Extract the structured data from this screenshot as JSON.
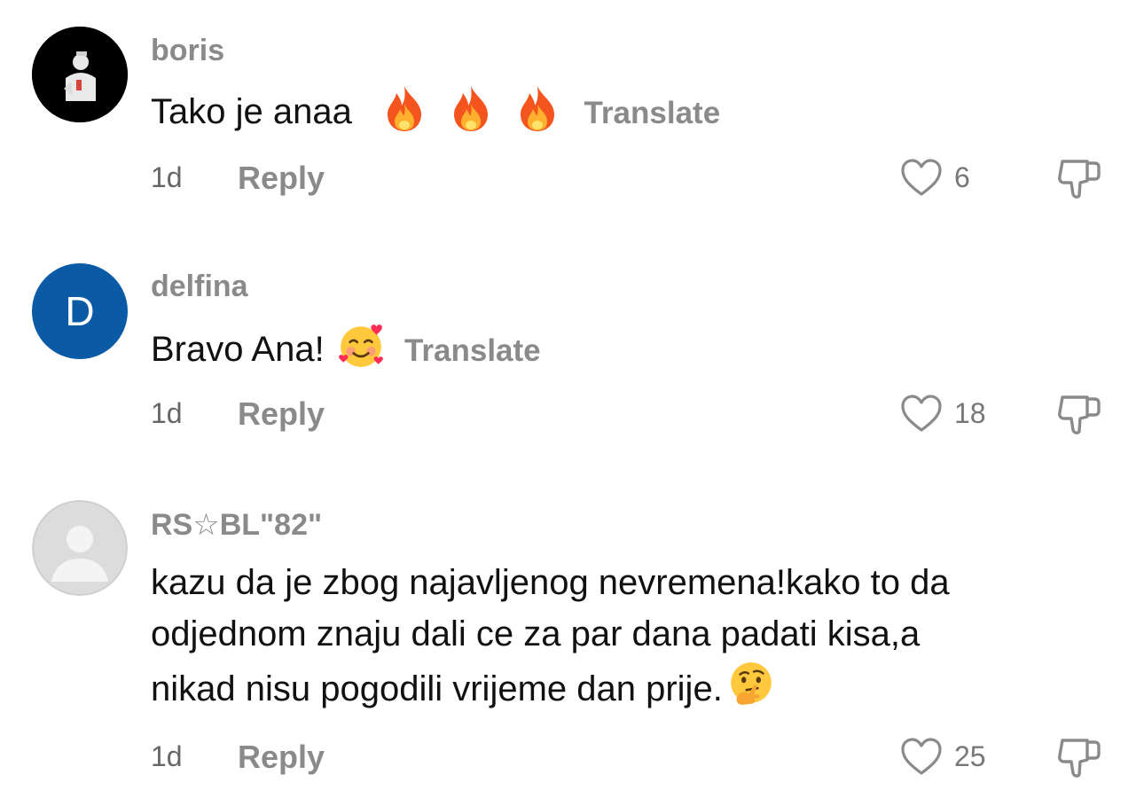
{
  "comments": [
    {
      "username": "boris",
      "text": "Tako je anaa",
      "emojis": [
        "fire-emoji",
        "fire-emoji",
        "fire-emoji"
      ],
      "translate_label": "Translate",
      "time": "1d",
      "reply_label": "Reply",
      "likes": "6",
      "avatar_type": "photo"
    },
    {
      "username": "delfina",
      "text": "Bravo Ana!",
      "emojis": [
        "smiling-face-with-hearts-emoji"
      ],
      "translate_label": "Translate",
      "time": "1d",
      "reply_label": "Reply",
      "likes": "18",
      "avatar_type": "letter",
      "avatar_letter": "D",
      "avatar_color": "#0b5aa6"
    },
    {
      "username": "RS☆BL\"82\"",
      "text_lines": [
        "kazu da je zbog najavljenog nevremena!kako to da",
        "odjednom znaju dali ce za par dana padati kisa,a",
        "nikad nisu pogodili vrijeme dan prije."
      ],
      "emojis": [
        "thinking-face-emoji"
      ],
      "time": "1d",
      "reply_label": "Reply",
      "likes": "25",
      "avatar_type": "default"
    }
  ]
}
